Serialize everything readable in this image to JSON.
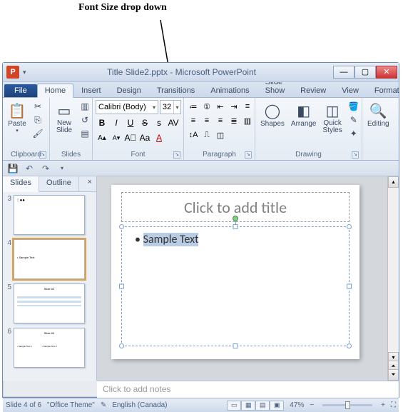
{
  "annotation": {
    "label": "Font Size drop down"
  },
  "titlebar": {
    "title": "Title Slide2.pptx - Microsoft PowerPoint"
  },
  "tabs": {
    "file": "File",
    "items": [
      "Home",
      "Insert",
      "Design",
      "Transitions",
      "Animations",
      "Slide Show",
      "Review",
      "View",
      "Format"
    ],
    "active": "Home"
  },
  "ribbon": {
    "clipboard": {
      "label": "Clipboard",
      "paste": "Paste"
    },
    "slides": {
      "label": "Slides",
      "newslide": "New\nSlide"
    },
    "font": {
      "label": "Font",
      "name": "Calibri (Body)",
      "size": "32"
    },
    "paragraph": {
      "label": "Paragraph"
    },
    "drawing": {
      "label": "Drawing",
      "shapes": "Shapes",
      "arrange": "Arrange",
      "quickstyles": "Quick\nStyles"
    },
    "editing": {
      "label": "Editing",
      "btn": "Editing"
    }
  },
  "panel": {
    "tab_slides": "Slides",
    "tab_outline": "Outline",
    "thumbs": [
      {
        "num": "3"
      },
      {
        "num": "4",
        "selected": true
      },
      {
        "num": "5"
      },
      {
        "num": "6"
      }
    ]
  },
  "slide": {
    "title_placeholder": "Click to add title",
    "bullet_text": "Sample Text"
  },
  "notes": {
    "placeholder": "Click to add notes"
  },
  "status": {
    "slide": "Slide 4 of 6",
    "theme": "\"Office Theme\"",
    "lang": "English (Canada)",
    "zoom": "47%"
  }
}
